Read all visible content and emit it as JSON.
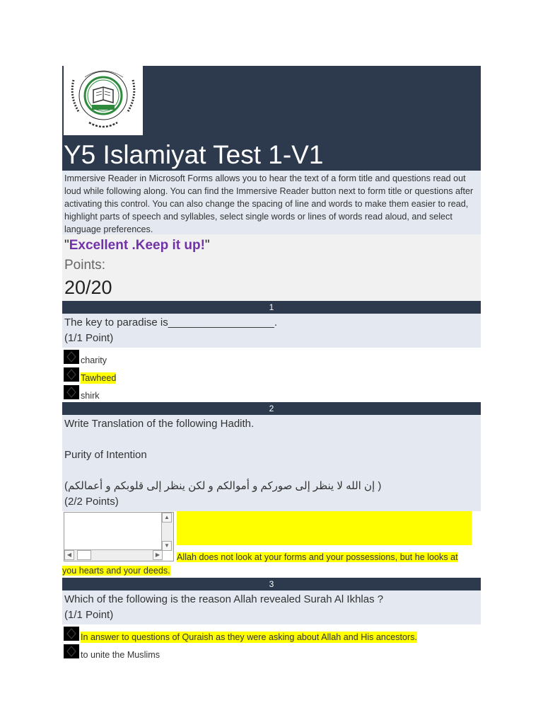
{
  "header": {
    "logo_text_top": "PAKISTAN INTERNATIONAL SCHOOL",
    "logo_text_bottom": "JEDDAH",
    "logo_inner_text": "ENGLISH SECTION",
    "title": "Y5 Islamiyat Test 1-V1"
  },
  "description": "Immersive Reader in Microsoft Forms allows you to hear the text of a form title and questions read out loud while following along. You can find the Immersive Reader button next to form title or questions after activating this control. You can also change the spacing of line and words to make them easier to read, highlight parts of speech and syllables, select single words or lines of words read aloud, and select language preferences.",
  "result": {
    "quote_open": "\"",
    "message": "Excellent .Keep it up!",
    "quote_close": "\"",
    "points_label": "Points:",
    "score": "20/20"
  },
  "questions": [
    {
      "number": "1",
      "text": "The key to paradise is__________________.",
      "points": "(1/1 Point)",
      "options": [
        "charity",
        "Tawheed",
        "shirk"
      ]
    },
    {
      "number": "2",
      "text_line1": "Write Translation of the following Hadith.",
      "text_line2": "Purity of Intention",
      "text_arabic": "( إن الله لا ينظر إلى صوركم و أموالكم و لكن ينظر إلى قلوبكم و أعمالكم)",
      "points": "(2/2 Points)",
      "answer": "Allah does not look at your forms and your possessions, but he looks at you hearts and your deeds."
    },
    {
      "number": "3",
      "text": "Which of the following is the reason Allah revealed Surah Al Ikhlas ?",
      "points": "(1/1 Point)",
      "options": [
        "In answer to questions of Quraish as they were asking about Allah and His ancestors.",
        "to unite the Muslims"
      ]
    }
  ],
  "colors": {
    "header_bg": "#2d3a4d",
    "section_bg": "#e3e8f1",
    "highlight": "#ffff00",
    "message_color": "#7132a8"
  }
}
